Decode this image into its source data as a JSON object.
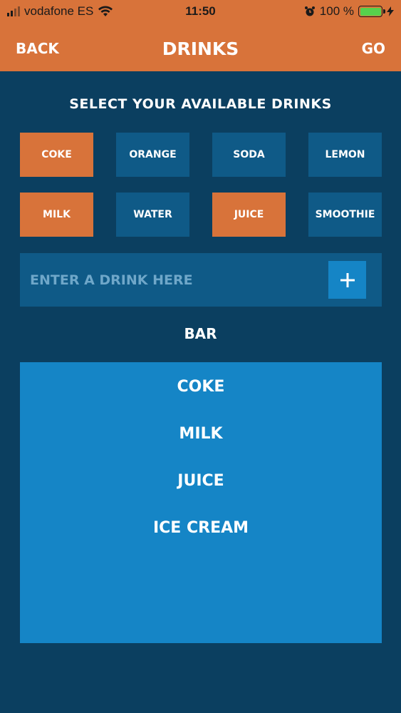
{
  "status_bar": {
    "carrier": "vodafone ES",
    "time": "11:50",
    "battery": "100 %"
  },
  "nav": {
    "back_label": "BACK",
    "title": "DRINKS",
    "go_label": "GO"
  },
  "select_title": "SELECT YOUR AVAILABLE DRINKS",
  "drinks": [
    {
      "label": "COKE",
      "selected": true
    },
    {
      "label": "ORANGE",
      "selected": false
    },
    {
      "label": "SODA",
      "selected": false
    },
    {
      "label": "LEMON",
      "selected": false
    },
    {
      "label": "MILK",
      "selected": true
    },
    {
      "label": "WATER",
      "selected": false
    },
    {
      "label": "JUICE",
      "selected": true
    },
    {
      "label": "SMOOTHIE",
      "selected": false
    }
  ],
  "entry": {
    "placeholder": "ENTER A DRINK HERE",
    "value": "",
    "add_icon": "plus-icon"
  },
  "bar": {
    "title": "BAR",
    "items": [
      "COKE",
      "MILK",
      "JUICE",
      "ICE CREAM"
    ]
  },
  "colors": {
    "background": "#0b3f60",
    "header": "#d8733a",
    "chip": "#0f5a87",
    "selected_chip": "#d8733a",
    "bar_box": "#1585c6"
  }
}
